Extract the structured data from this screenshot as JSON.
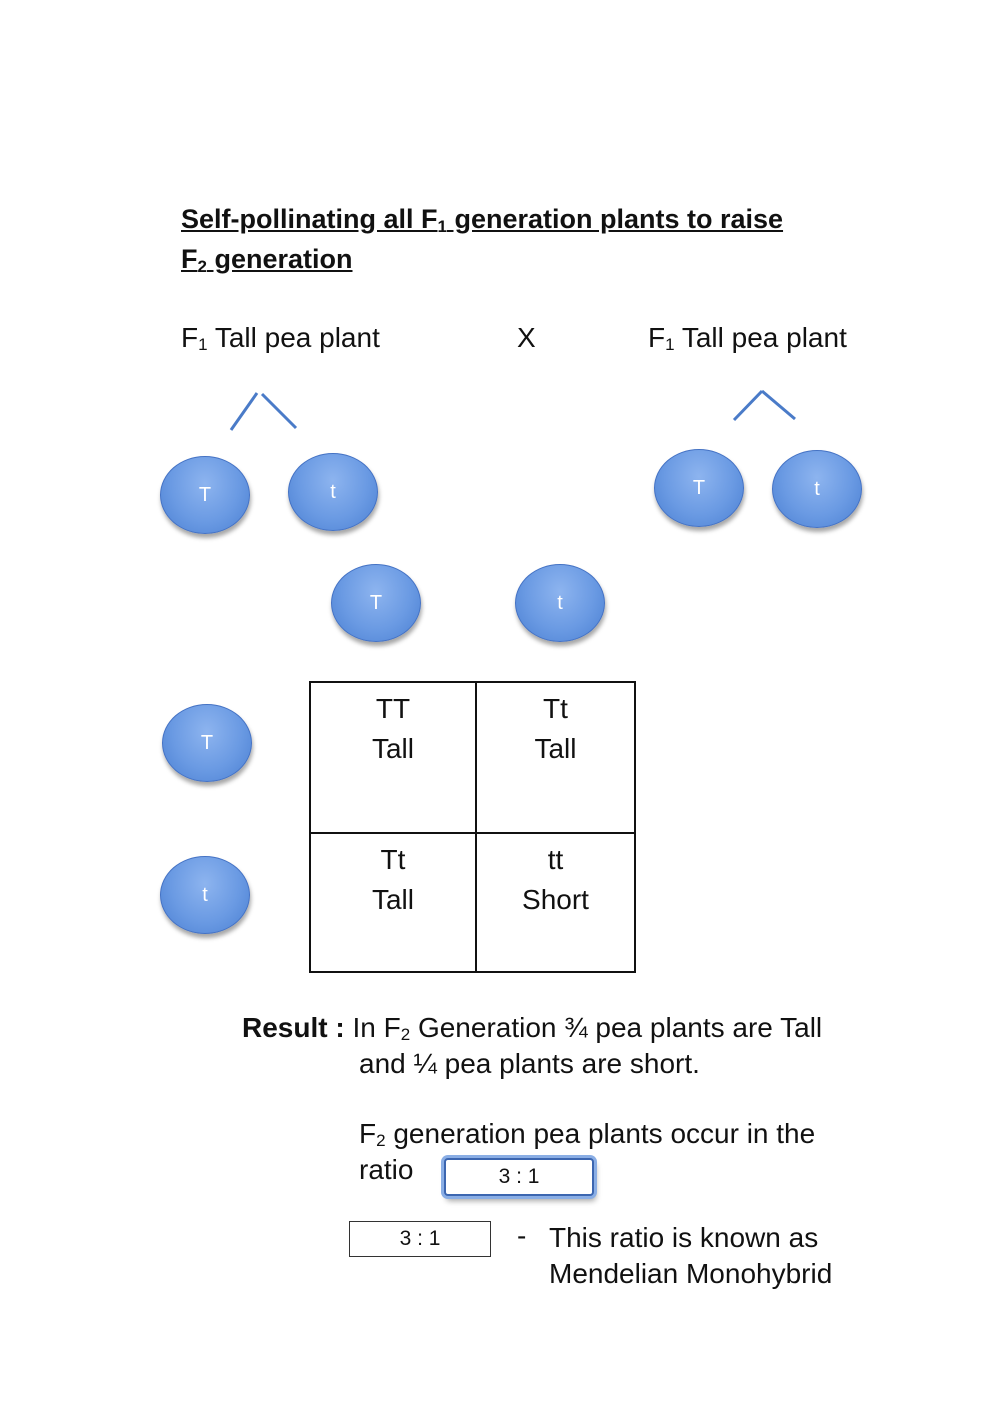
{
  "title": {
    "line1_pre": "Self-pollinating all F",
    "line1_sub": "1",
    "line1_post": " generation plants to raise",
    "line2_pre": "F",
    "line2_sub": "2",
    "line2_post": " generation"
  },
  "cross": {
    "left_parent": {
      "pre": "F",
      "sub": "1",
      "post": " Tall pea plant"
    },
    "cross_symbol": "X",
    "right_parent": {
      "pre": "F",
      "sub": "1",
      "post": " Tall pea plant"
    }
  },
  "gametes": {
    "left_parent": [
      "T",
      "t"
    ],
    "right_parent": [
      "T",
      "t"
    ],
    "punnett_top": [
      "T",
      "t"
    ],
    "punnett_side": [
      "T",
      "t"
    ]
  },
  "punnett": {
    "rows": [
      [
        {
          "genotype": "TT",
          "phenotype": "Tall"
        },
        {
          "genotype": "Tt",
          "phenotype": "Tall"
        }
      ],
      [
        {
          "genotype": "Tt",
          "phenotype": "Tall"
        },
        {
          "genotype": "tt",
          "phenotype": "Short"
        }
      ]
    ]
  },
  "result": {
    "label": "Result :",
    "line1_pre": " In F",
    "line1_sub": "2",
    "line1_post": " Generation ¾ pea plants are Tall",
    "line2": "and ¼ pea plants are short.",
    "ratio_pre": "F",
    "ratio_sub": "2",
    "ratio_post": " generation pea plants occur in the",
    "ratio_word": "ratio",
    "answer_box_value": "3 : 1",
    "second_box_value": "3 : 1",
    "dash": "-",
    "known_line1": "This ratio is known as",
    "known_line2": "Mendelian Monohybrid"
  },
  "colors": {
    "gamete_fill": "#6a9ae3",
    "gamete_border": "#4472c4",
    "line_color": "#4a7bc8"
  }
}
